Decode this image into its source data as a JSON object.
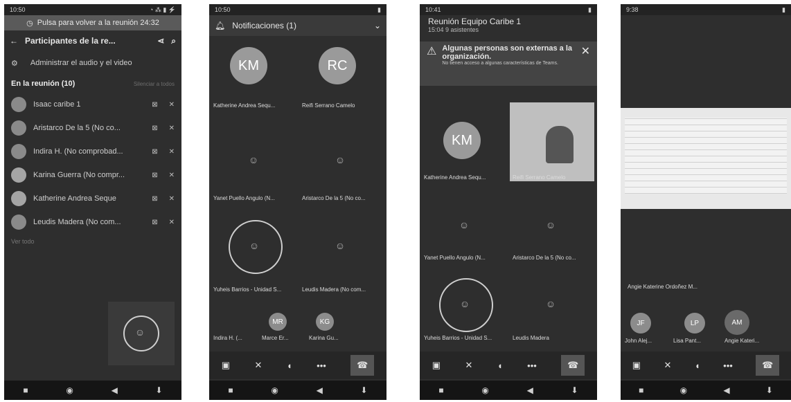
{
  "p1": {
    "status": {
      "time": "10:50",
      "icons": "◔ ⁂ ▮ ⚡"
    },
    "banner": "Pulsa para volver a la reunión 24:32",
    "title": "Participantes de la re...",
    "manage": "Administrar el audio y el video",
    "section": "En la reunión (10)",
    "mute_all": "Silenciar a todos",
    "participants": [
      "Isaac caribe 1",
      "Aristarco De la 5 (No co...",
      "Indira H. (No comprobad...",
      "Karina Guerra (No compr...",
      "Katherine Andrea Seque",
      "Leudis Madera (No com..."
    ],
    "see_all": "Ver todo"
  },
  "p2": {
    "status": {
      "time": "10:50"
    },
    "notif": "Notificaciones (1)",
    "tiles": {
      "km": "KM",
      "rc": "RC",
      "n1": "Katherine Andrea Sequ...",
      "n2": "Reifi Serrano Camelo",
      "n3": "Yanet Puello Angulo (N...",
      "n4": "Aristarco De la 5 (No co...",
      "n5": "Yuheis Barrios - Unidad S...",
      "n6": "Leudis Madera (No com..."
    },
    "bottom": {
      "n1": "Indira H. (...",
      "n2": "Marce Er...",
      "n3": "Karina Gu...",
      "mr": "MR",
      "kg": "KG"
    }
  },
  "p3": {
    "status": {
      "time": "10:41"
    },
    "meeting": "Reunión Equipo Caribe 1",
    "sub": "15:04  9 asistentes",
    "warn_title": "Algunas personas son externas a la organización.",
    "warn_body": "No tienen acceso a algunas características de Teams.",
    "tiles": {
      "km": "KM",
      "n1": "Katherine Andrea Sequ...",
      "n2": "Reifi Serrano Camelo",
      "n3": "Yanet Puello Angulo (N...",
      "n4": "Aristarco De la 5 (No co...",
      "n5": "Yuheis Barrios - Unidad S...",
      "n6": "Leudis Madera"
    }
  },
  "p4": {
    "status": {
      "time": "9:38"
    },
    "presenter": "Angie Katerine Ordoñez M...",
    "bottom": {
      "n1": "John Alej...",
      "n2": "Lisa Pant...",
      "n3": "Angie Kateri...",
      "jr": "JF",
      "lp": "LP",
      "am": "AM"
    }
  }
}
